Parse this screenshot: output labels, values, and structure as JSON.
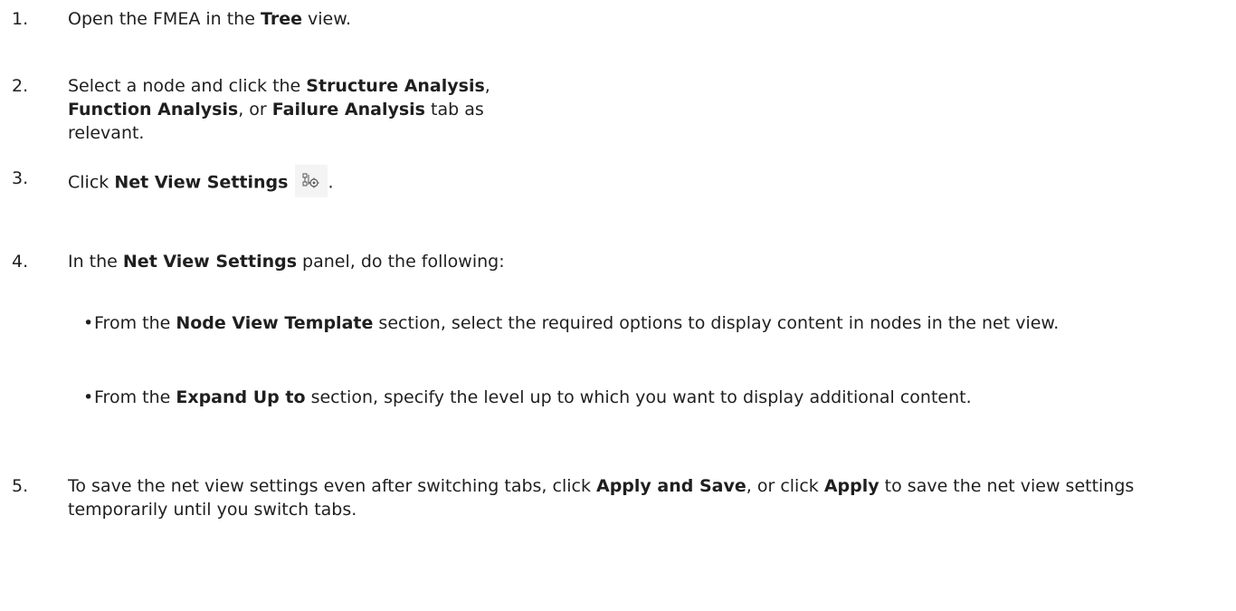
{
  "steps": [
    {
      "number": "1.",
      "pre": "Open the FMEA in the ",
      "b1": "Tree",
      "post": " view."
    },
    {
      "number": "2.",
      "pre": "Select a node and click the ",
      "b1": "Structure Analysis",
      "mid1": ", ",
      "b2": "Function Analysis",
      "mid2": ", or ",
      "b3": "Failure Analysis",
      "post": " tab as relevant."
    },
    {
      "number": "3.",
      "pre": "Click ",
      "b1": "Net View Settings",
      "icon": "net-view-settings-icon",
      "post": "."
    },
    {
      "number": "4.",
      "pre": "In the ",
      "b1": "Net View Settings",
      "post": " panel, do the following:",
      "bullets": [
        {
          "pre": "From the ",
          "b1": "Node View Template",
          "post": " section, select the required options to display content in nodes in the net view."
        },
        {
          "pre": "From the ",
          "b1": "Expand Up to",
          "post": " section, specify the level up to which you want to display additional content."
        }
      ]
    },
    {
      "number": "5.",
      "pre": "To save the net view settings even after switching tabs, click ",
      "b1": "Apply and Save",
      "mid1": ", or click ",
      "b2": "Apply",
      "post": " to save the net view settings temporarily until you switch tabs."
    }
  ],
  "bullet_char": "•",
  "colors": {
    "text": "#1f1f1f",
    "icon_bg": "#f4f4f4",
    "icon_stroke": "#555555"
  }
}
